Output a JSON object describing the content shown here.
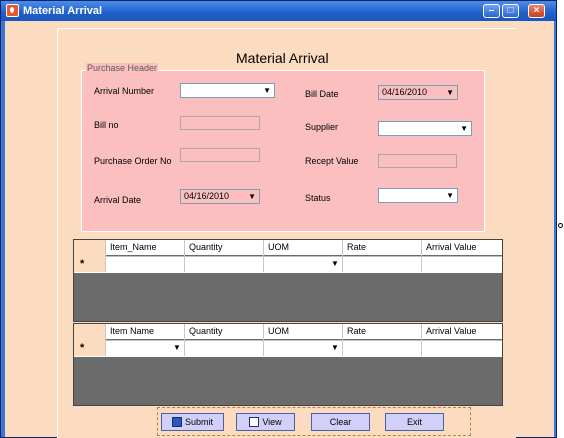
{
  "window": {
    "title": "Material Arrival",
    "minimize": "–",
    "maximize": "□",
    "close": "×"
  },
  "form": {
    "title": "Material Arrival"
  },
  "purchase_header": {
    "legend": "Purchase Header",
    "arrival_number_label": "Arrival Number",
    "arrival_number_value": "",
    "bill_no_label": "Bill no",
    "bill_no_value": "",
    "po_no_label": "Purchase Order No",
    "po_no_value": "",
    "arrival_date_label": "Arrival Date",
    "arrival_date_value": "04/16/2010",
    "bill_date_label": "Bill Date",
    "bill_date_value": "04/16/2010",
    "supplier_label": "Supplier",
    "supplier_value": "",
    "receipt_value_label": "Recept Value",
    "receipt_value_value": "",
    "status_label": "Status",
    "status_value": ""
  },
  "grid1": {
    "columns": [
      "Item_Name",
      "Quantity",
      "UOM",
      "Rate",
      "Arrival Value"
    ],
    "new_row_marker": "*"
  },
  "grid2": {
    "columns": [
      "Item Name",
      "Quantity",
      "UOM",
      "Rate",
      "Arrival Value"
    ],
    "new_row_marker": "*"
  },
  "buttons": {
    "submit": "Submit",
    "view": "View",
    "clear": "Clear",
    "exit": "Exit"
  },
  "icons": {
    "dropdown": "chevron-down-icon",
    "submit": "save-icon",
    "view": "book-icon"
  }
}
